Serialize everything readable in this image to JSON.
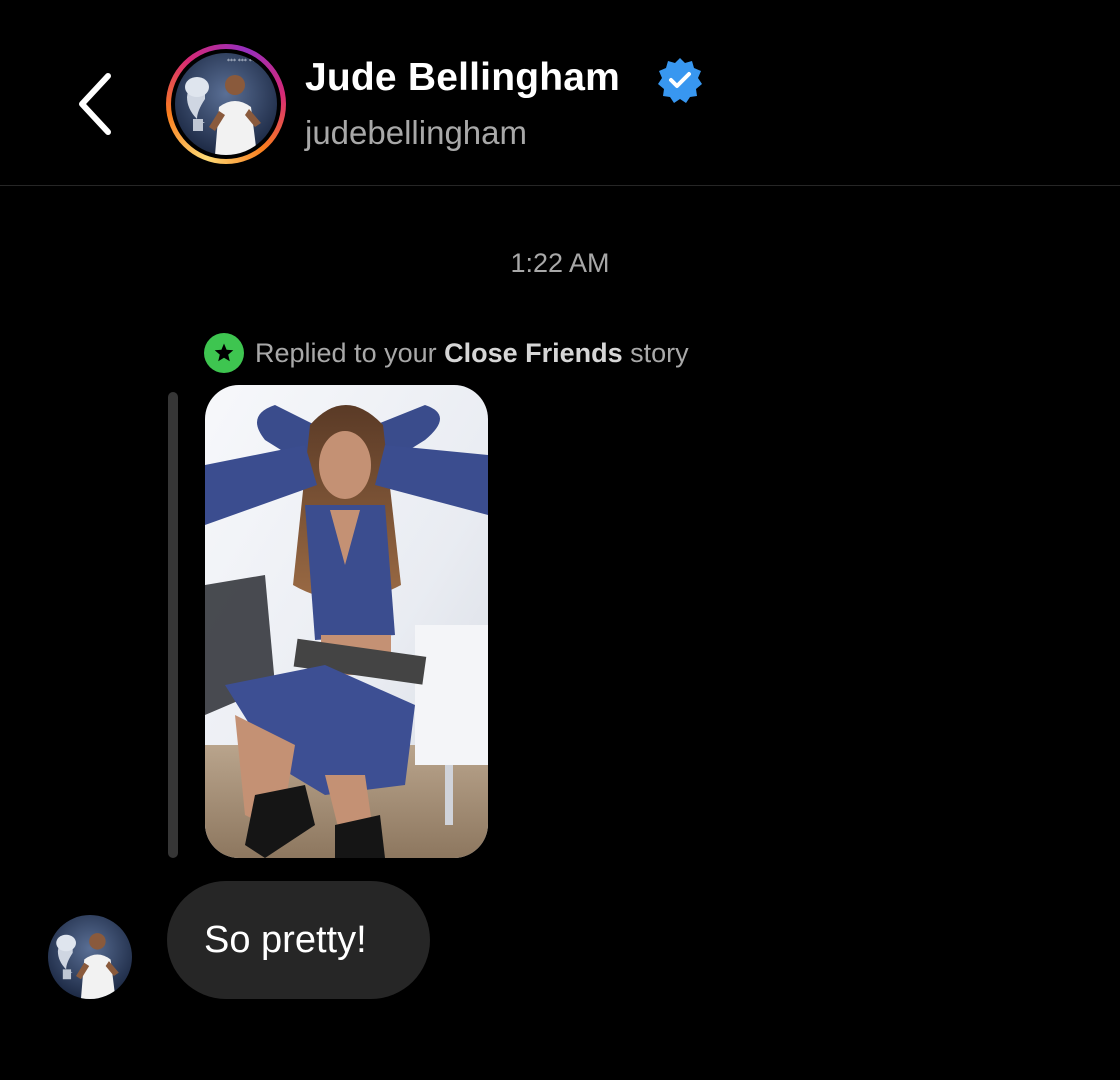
{
  "header": {
    "display_name": "Jude Bellingham",
    "username": "judebellingham",
    "verified": true,
    "back_icon": "chevron-left-icon",
    "verified_icon": "verified-badge-icon"
  },
  "thread": {
    "timestamp": "1:22 AM",
    "story_reply": {
      "prefix": "Replied to your ",
      "emphasis": "Close Friends",
      "suffix": " story",
      "icon": "star-icon"
    },
    "message": {
      "text": "So pretty!"
    }
  },
  "colors": {
    "background": "#000000",
    "bubble": "#262626",
    "secondary_text": "#a8a8a8",
    "close_friends_green": "#3ec550",
    "verified_blue": "#3897f0"
  }
}
